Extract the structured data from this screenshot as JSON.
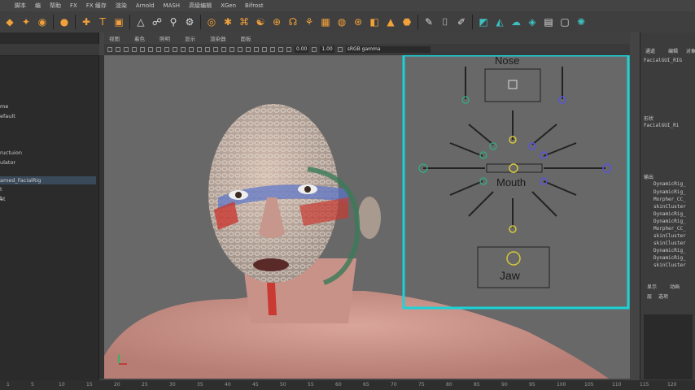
{
  "menubar": [
    "脚本",
    "编",
    "帮助",
    "FX",
    "FX 缓存",
    "渲染",
    "Arnold",
    "MASH",
    "高级编辑",
    "XGen",
    "Bifrost"
  ],
  "viewport_panel_menu": [
    "视图",
    "着色",
    "照明",
    "显示",
    "渲染器",
    "面板"
  ],
  "viewport_toolbar": {
    "field_a": "0.00",
    "field_b": "1.00",
    "colorspace": "sRGB gamma"
  },
  "outliner": {
    "items": [
      {
        "label": "me",
        "selected": false
      },
      {
        "label": "efault",
        "selected": false
      },
      {
        "label": "",
        "selected": false
      },
      {
        "label": "",
        "selected": false
      },
      {
        "label": "ructuion",
        "selected": false
      },
      {
        "label": "ulator",
        "selected": false
      },
      {
        "label": "",
        "selected": false
      },
      {
        "label": "amed_FacialRig",
        "selected": true
      },
      {
        "label": "t",
        "selected": false
      },
      {
        "label": "t",
        "selected": false
      },
      {
        "label": "et",
        "selected": false
      }
    ]
  },
  "face_ui": {
    "nose_label": "Nose",
    "mouth_label": "Mouth",
    "jaw_label": "Jaw"
  },
  "right_panel": {
    "tabs": [
      "通道",
      "编辑",
      "对象"
    ],
    "node_top": "FacialGUI_RIG",
    "shapes_label": "形状",
    "shapes_node": "FacialGUI_Ri",
    "outputs_label": "输出",
    "outputs": [
      "DynamicRig_",
      "DynamicRig_",
      "Morpher_CC_",
      "skinCluster",
      "DynamicRig_",
      "DynamicRig_",
      "Morpher_CC_",
      "skinCluster",
      "skinCluster",
      "DynamicRig_",
      "DynamicRig_",
      "skinCluster"
    ],
    "bottom_tabs": [
      "显示",
      "动画"
    ],
    "bottom_labels": [
      "层",
      "选项"
    ]
  },
  "timeline": [
    "1",
    "5",
    "10",
    "15",
    "20",
    "25",
    "30",
    "35",
    "40",
    "45",
    "50",
    "55",
    "60",
    "65",
    "70",
    "75",
    "80",
    "85",
    "90",
    "95",
    "100",
    "105",
    "110",
    "115",
    "120"
  ],
  "colors": {
    "accent_cyan": "#19d3d8",
    "shelf_orange": "#f2a13a",
    "controller_green": "#3aa37b",
    "controller_yellow": "#d6c73a",
    "controller_blue": "#5a55d6"
  }
}
